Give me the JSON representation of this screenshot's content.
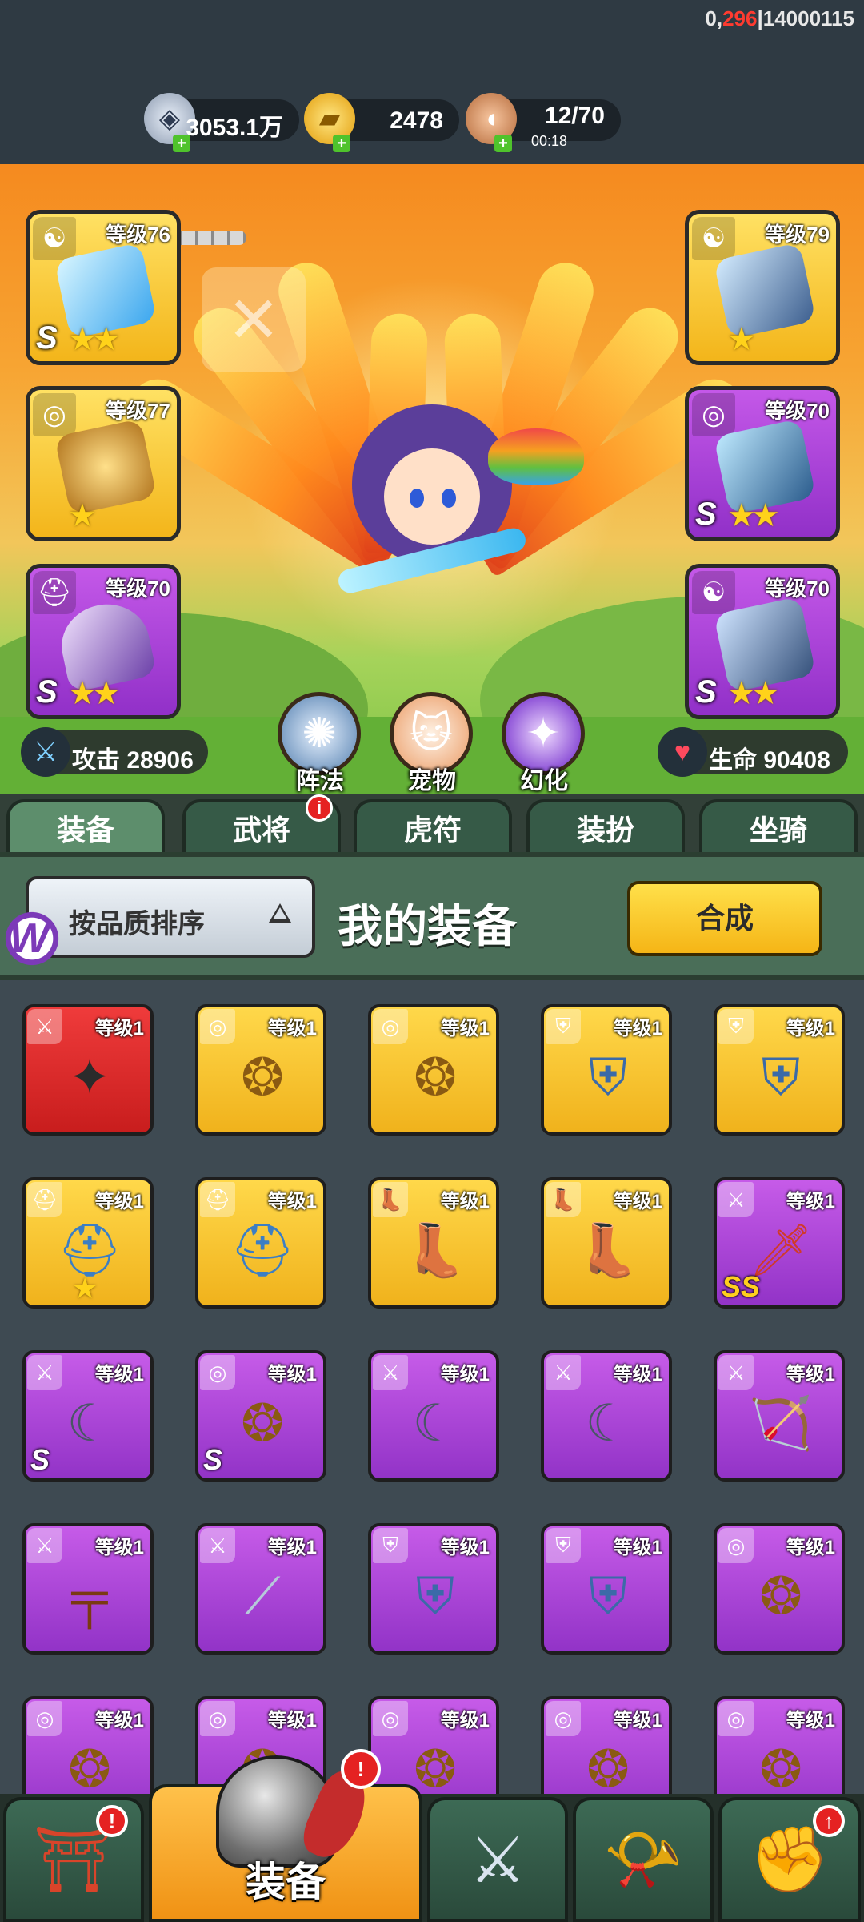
{
  "debug": {
    "part1": "0,",
    "part2": "296",
    "part3": "|14000115"
  },
  "resources": [
    {
      "icon": "silver-coin-icon",
      "value": "3053.1万"
    },
    {
      "icon": "gold-ingot-icon",
      "value": "2478"
    },
    {
      "icon": "meat-stamina-icon",
      "value": "12/70",
      "timer": "00:18"
    }
  ],
  "slots": {
    "left": [
      {
        "type_icon": "yin-yang-icon",
        "level": "等级76",
        "grade": "S",
        "stars": "★★"
      },
      {
        "type_icon": "medal-icon",
        "level": "等级77",
        "grade": "",
        "stars": "★"
      },
      {
        "type_icon": "helmet-icon",
        "level": "等级70",
        "grade": "S",
        "stars": "★★"
      }
    ],
    "right": [
      {
        "type_icon": "yin-yang-icon",
        "level": "等级79",
        "grade": "",
        "stars": "★"
      },
      {
        "type_icon": "medal-icon",
        "level": "等级70",
        "grade": "S",
        "stars": "★★"
      },
      {
        "type_icon": "yin-yang-icon",
        "level": "等级70",
        "grade": "S",
        "stars": "★★"
      }
    ]
  },
  "stats": {
    "attack_label": "攻击 28906",
    "hp_label": "生命 90408"
  },
  "feature_buttons": [
    "阵法",
    "宠物",
    "幻化"
  ],
  "tabs": [
    "装备",
    "武将",
    "虎符",
    "装扮",
    "坐骑"
  ],
  "tab_badge": "i",
  "panel": {
    "sort_label": "按品质排序",
    "title": "我的装备",
    "synth_label": "合成"
  },
  "items": [
    {
      "rarity": "red",
      "type_icon": "sword-icon",
      "art": "shuriken-icon",
      "level": "等级1",
      "grade": "",
      "star": ""
    },
    {
      "rarity": "gold",
      "type_icon": "medal-icon",
      "art": "amulet-icon",
      "level": "等级1",
      "grade": "",
      "star": ""
    },
    {
      "rarity": "gold",
      "type_icon": "medal-icon",
      "art": "amulet-icon",
      "level": "等级1",
      "grade": "",
      "star": ""
    },
    {
      "rarity": "gold",
      "type_icon": "armor-icon",
      "art": "armor-icon",
      "level": "等级1",
      "grade": "",
      "star": ""
    },
    {
      "rarity": "gold",
      "type_icon": "armor-icon",
      "art": "armor-icon",
      "level": "等级1",
      "grade": "",
      "star": ""
    },
    {
      "rarity": "gold",
      "type_icon": "helmet-icon",
      "art": "helmet-icon",
      "level": "等级1",
      "grade": "",
      "star": "★"
    },
    {
      "rarity": "gold",
      "type_icon": "helmet-icon",
      "art": "helmet-icon",
      "level": "等级1",
      "grade": "",
      "star": ""
    },
    {
      "rarity": "gold",
      "type_icon": "boot-icon",
      "art": "boot-icon",
      "level": "等级1",
      "grade": "",
      "star": ""
    },
    {
      "rarity": "gold",
      "type_icon": "boot-icon",
      "art": "boot-icon",
      "level": "等级1",
      "grade": "",
      "star": ""
    },
    {
      "rarity": "purple",
      "type_icon": "sword-icon",
      "art": "weapon-icon",
      "level": "等级1",
      "grade": "SS",
      "star": ""
    },
    {
      "rarity": "purple",
      "type_icon": "sword-icon",
      "art": "blade-icon",
      "level": "等级1",
      "grade": "S",
      "star": ""
    },
    {
      "rarity": "purple",
      "type_icon": "medal-icon",
      "art": "amulet-icon",
      "level": "等级1",
      "grade": "S",
      "star": ""
    },
    {
      "rarity": "purple",
      "type_icon": "sword-icon",
      "art": "blade-icon",
      "level": "等级1",
      "grade": "",
      "star": ""
    },
    {
      "rarity": "purple",
      "type_icon": "sword-icon",
      "art": "blade-icon",
      "level": "等级1",
      "grade": "",
      "star": ""
    },
    {
      "rarity": "purple",
      "type_icon": "sword-icon",
      "art": "bow-icon",
      "level": "等级1",
      "grade": "",
      "star": ""
    },
    {
      "rarity": "purple",
      "type_icon": "sword-icon",
      "art": "gun-icon",
      "level": "等级1",
      "grade": "",
      "star": ""
    },
    {
      "rarity": "purple",
      "type_icon": "sword-icon",
      "art": "glaive-icon",
      "level": "等级1",
      "grade": "",
      "star": ""
    },
    {
      "rarity": "purple",
      "type_icon": "armor-icon",
      "art": "armor-icon",
      "level": "等级1",
      "grade": "",
      "star": ""
    },
    {
      "rarity": "purple",
      "type_icon": "armor-icon",
      "art": "armor-icon",
      "level": "等级1",
      "grade": "",
      "star": ""
    },
    {
      "rarity": "purple",
      "type_icon": "medal-icon",
      "art": "amulet-icon",
      "level": "等级1",
      "grade": "",
      "star": ""
    },
    {
      "rarity": "purple",
      "type_icon": "medal-icon",
      "art": "amulet-icon",
      "level": "等级1",
      "grade": "",
      "star": ""
    },
    {
      "rarity": "purple",
      "type_icon": "medal-icon",
      "art": "amulet-icon",
      "level": "等级1",
      "grade": "",
      "star": ""
    },
    {
      "rarity": "purple",
      "type_icon": "medal-icon",
      "art": "amulet-icon",
      "level": "等级1",
      "grade": "",
      "star": ""
    },
    {
      "rarity": "purple",
      "type_icon": "medal-icon",
      "art": "amulet-icon",
      "level": "等级1",
      "grade": "",
      "star": ""
    },
    {
      "rarity": "purple",
      "type_icon": "medal-icon",
      "art": "amulet-icon",
      "level": "等级1",
      "grade": "",
      "star": ""
    }
  ],
  "bottom_nav": [
    {
      "icon": "gate-coin-icon",
      "label": "",
      "badge": "!"
    },
    {
      "icon": "helmet-icon",
      "label": "装备",
      "badge": "!"
    },
    {
      "icon": "crossed-swords-icon",
      "label": "",
      "badge": ""
    },
    {
      "icon": "horn-stars-icon",
      "label": "",
      "badge": ""
    },
    {
      "icon": "fist-upgrade-icon",
      "label": "",
      "badge": "↑"
    }
  ],
  "colors": {
    "gold_slot": "#f3b51a",
    "purple_slot": "#9130c8",
    "red_slot": "#c81d1d",
    "accent_green": "#4fc32c"
  }
}
